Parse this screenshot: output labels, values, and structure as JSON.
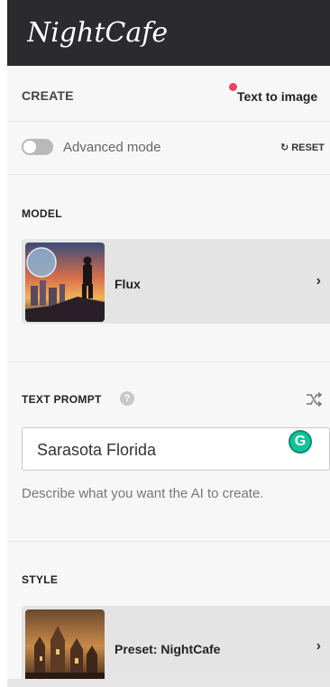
{
  "header": {
    "logo_text": "NightCafe"
  },
  "create": {
    "label": "CREATE",
    "mode": "Text to image"
  },
  "controls": {
    "advanced_mode_label": "Advanced mode",
    "advanced_mode_on": false,
    "reset_label": "RESET"
  },
  "model": {
    "title": "MODEL",
    "name": "Flux"
  },
  "prompt": {
    "title": "TEXT PROMPT",
    "help_symbol": "?",
    "value": "Sarasota Florida",
    "hint": "Describe what you want the AI to create."
  },
  "style": {
    "title": "STYLE",
    "name": "Preset: NightCafe"
  },
  "icons": {
    "reset": "refresh-icon",
    "chevron": "chevron-right-icon",
    "shuffle": "shuffle-icon",
    "grammarly": "grammarly-icon"
  },
  "colors": {
    "header_bg": "#2b2b2f",
    "accent_dot": "#e8445f",
    "grammarly": "#15c39a"
  }
}
